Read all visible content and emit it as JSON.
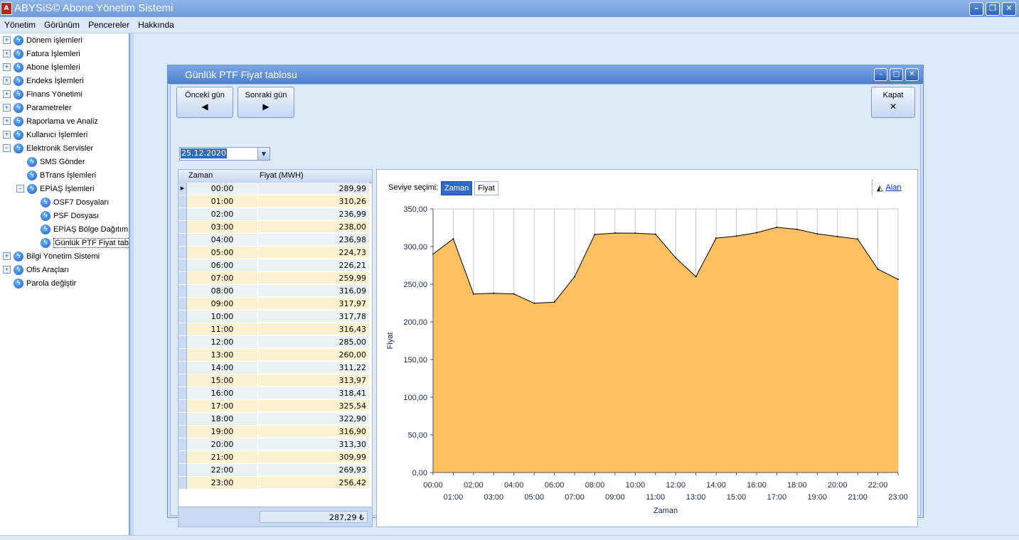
{
  "app": {
    "title": "ABYSiS© Abone Yönetim Sistemi",
    "icon": "app-logo-icon",
    "window_buttons": [
      "minimize-icon",
      "restore-icon",
      "close-icon"
    ]
  },
  "menu": [
    "Yönetim",
    "Görünüm",
    "Pencereler",
    "Hakkında"
  ],
  "sidebar": {
    "items": [
      {
        "label": "Dönem işlemleri",
        "level": 0,
        "expander": "+"
      },
      {
        "label": "Fatura İşlemleri",
        "level": 0,
        "expander": "+"
      },
      {
        "label": "Abone İşlemleri",
        "level": 0,
        "expander": "+"
      },
      {
        "label": "Endeks İşlemleri",
        "level": 0,
        "expander": "+"
      },
      {
        "label": "Finans Yönetimi",
        "level": 0,
        "expander": "+"
      },
      {
        "label": "Parametreler",
        "level": 0,
        "expander": "+"
      },
      {
        "label": "Raporlama ve Analiz",
        "level": 0,
        "expander": "+"
      },
      {
        "label": "Kullanıcı İşlemleri",
        "level": 0,
        "expander": "+"
      },
      {
        "label": "Elektronik Servisler",
        "level": 0,
        "expander": "−"
      },
      {
        "label": "SMS Gönder",
        "level": 1,
        "expander": ""
      },
      {
        "label": "BTrans İşlemleri",
        "level": 1,
        "expander": ""
      },
      {
        "label": "EPİAŞ İşlemleri",
        "level": 1,
        "expander": "−"
      },
      {
        "label": "OSF7 Dosyaları",
        "level": 2,
        "expander": ""
      },
      {
        "label": "PSF Dosyası",
        "level": 2,
        "expander": ""
      },
      {
        "label": "EPİAŞ Bölge Dağıtım :",
        "level": 2,
        "expander": ""
      },
      {
        "label": "Günlük PTF Fiyat tabl",
        "level": 2,
        "expander": "",
        "selected": true
      },
      {
        "label": "Bilgi Yönetim Sistemi",
        "level": 0,
        "expander": "+"
      },
      {
        "label": "Ofis Araçları",
        "level": 0,
        "expander": "+"
      },
      {
        "label": "Parola değiştir",
        "level": 0,
        "expander": ""
      }
    ]
  },
  "child_window": {
    "title": "Günlük PTF Fiyat tablosu",
    "prev_button": "Önceki gün",
    "next_button": "Sonraki gün",
    "close_button": "Kapat",
    "date_value": "25.12.2020"
  },
  "grid": {
    "columns": [
      "Zaman",
      "Fiyat (MWH)"
    ],
    "rows": [
      [
        "00:00",
        "289,99"
      ],
      [
        "01:00",
        "310,26"
      ],
      [
        "02:00",
        "236,99"
      ],
      [
        "03:00",
        "238,00"
      ],
      [
        "04:00",
        "236,98"
      ],
      [
        "05:00",
        "224,73"
      ],
      [
        "06:00",
        "226,21"
      ],
      [
        "07:00",
        "259,99"
      ],
      [
        "08:00",
        "316,09"
      ],
      [
        "09:00",
        "317,97"
      ],
      [
        "10:00",
        "317,78"
      ],
      [
        "11:00",
        "316,43"
      ],
      [
        "12:00",
        "285,00"
      ],
      [
        "13:00",
        "260,00"
      ],
      [
        "14:00",
        "311,22"
      ],
      [
        "15:00",
        "313,97"
      ],
      [
        "16:00",
        "318,41"
      ],
      [
        "17:00",
        "325,54"
      ],
      [
        "18:00",
        "322,90"
      ],
      [
        "19:00",
        "316,90"
      ],
      [
        "20:00",
        "313,30"
      ],
      [
        "21:00",
        "309,99"
      ],
      [
        "22:00",
        "269,93"
      ],
      [
        "23:00",
        "256,42"
      ]
    ],
    "footer_total": "287,29 ₺"
  },
  "chart_controls": {
    "level_label": "Seviye seçimi:",
    "level_options": [
      "Zaman",
      "Fiyat"
    ],
    "active_level": "Zaman",
    "chart_type_link": "Alan"
  },
  "chart_data": {
    "type": "area",
    "x": [
      "00:00",
      "01:00",
      "02:00",
      "03:00",
      "04:00",
      "05:00",
      "06:00",
      "07:00",
      "08:00",
      "09:00",
      "10:00",
      "11:00",
      "12:00",
      "13:00",
      "14:00",
      "15:00",
      "16:00",
      "17:00",
      "18:00",
      "19:00",
      "20:00",
      "21:00",
      "22:00",
      "23:00"
    ],
    "series": [
      {
        "values": [
          289.99,
          310.26,
          236.99,
          238.0,
          236.98,
          224.73,
          226.21,
          259.99,
          316.09,
          317.97,
          317.78,
          316.43,
          285.0,
          260.0,
          311.22,
          313.97,
          318.41,
          325.54,
          322.9,
          316.9,
          313.3,
          309.99,
          269.93,
          256.42
        ],
        "color": "#ffc061"
      }
    ],
    "ylim": [
      0,
      350
    ],
    "yticks": [
      "0,00",
      "50,00",
      "100,00",
      "150,00",
      "200,00",
      "250,00",
      "300,00",
      "350,00"
    ],
    "xlabel": "Zaman",
    "ylabel": "Fiyat",
    "grid": "vertical",
    "colors": {
      "fill": "#ffc061",
      "line": "#000000",
      "grid": "#c8c8c8"
    }
  }
}
